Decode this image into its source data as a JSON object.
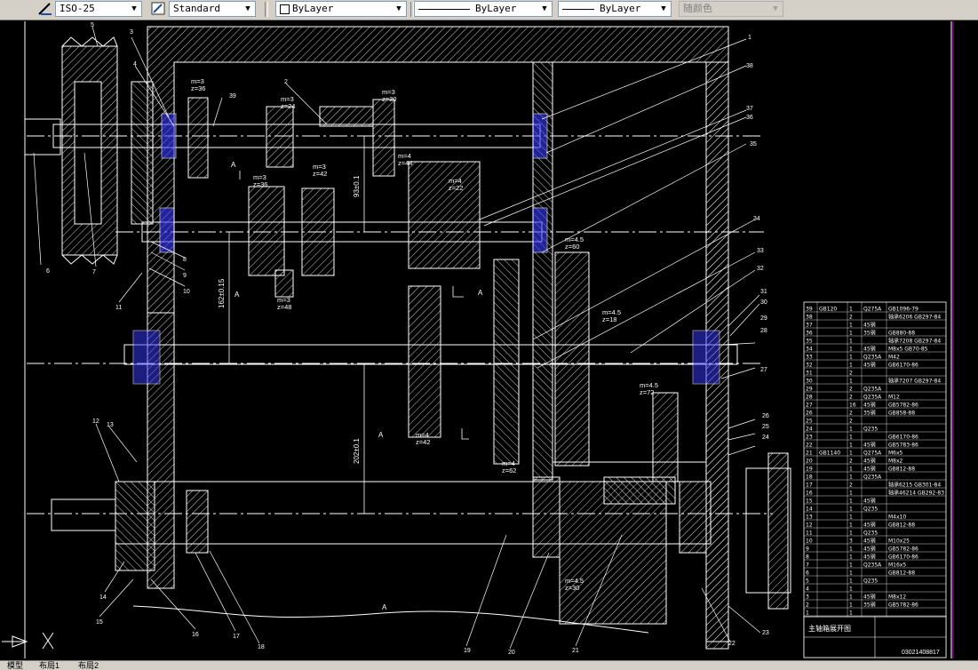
{
  "toolbar": {
    "dimstyle": "ISO-25",
    "textstyle": "Standard",
    "layer": "ByLayer",
    "linetype": "ByLayer",
    "lineweight": "ByLayer",
    "color": "随颜色"
  },
  "layout_tabs": [
    "模型",
    "布局1",
    "布局2"
  ],
  "callouts": [
    "1",
    "2",
    "3",
    "4",
    "5",
    "6",
    "7",
    "8",
    "9",
    "10",
    "11",
    "12",
    "13",
    "14",
    "15",
    "16",
    "17",
    "18",
    "19",
    "20",
    "21",
    "22",
    "23",
    "24",
    "25",
    "26",
    "27",
    "28",
    "29",
    "30",
    "31",
    "32",
    "33",
    "34",
    "35",
    "36",
    "37",
    "38",
    "39"
  ],
  "gear_notes": {
    "g1": [
      "m=3",
      "z=36"
    ],
    "g2": [
      "m=3",
      "z=24"
    ],
    "g3": [
      "m=3",
      "z=30"
    ],
    "g4": [
      "m=4",
      "z=44"
    ],
    "g5": [
      "m=3",
      "z=36"
    ],
    "g6": [
      "m=3",
      "z=42"
    ],
    "g7": [
      "m=4",
      "z=22"
    ],
    "g8": [
      "m=3",
      "z=48"
    ],
    "g9": [
      "m=4.5",
      "z=60"
    ],
    "g10": [
      "m=4.5",
      "z=18"
    ],
    "g11": [
      "m=4.5",
      "z=72"
    ],
    "g12": [
      "m=4",
      "z=42"
    ],
    "g13": [
      "m=4",
      "z=62"
    ],
    "g14": [
      "m=4.5",
      "z=30"
    ]
  },
  "dims": {
    "d1": "93±0.1",
    "d2": "162±0.15",
    "d3": "202±0.1"
  },
  "section_mark": "A",
  "bom_rows": [
    [
      "39",
      "GB120",
      "1",
      "Q275A",
      "GB1096-79"
    ],
    [
      "38",
      "",
      "2",
      "",
      "轴承6206 GB297-84"
    ],
    [
      "37",
      "",
      "1",
      "45钢",
      ""
    ],
    [
      "36",
      "",
      "1",
      "35钢",
      "GB880-88"
    ],
    [
      "35",
      "",
      "1",
      "",
      "轴承7208 GB297-84"
    ],
    [
      "34",
      "",
      "1",
      "45钢",
      "M8x5 GB70-85"
    ],
    [
      "33",
      "",
      "1",
      "Q235A",
      "M42"
    ],
    [
      "32",
      "",
      "1",
      "45钢",
      "GB6170-86"
    ],
    [
      "31",
      "",
      "2",
      "",
      ""
    ],
    [
      "30",
      "",
      "1",
      "",
      "轴承7207 GB297-84"
    ],
    [
      "29",
      "",
      "2",
      "Q235A",
      ""
    ],
    [
      "28",
      "",
      "2",
      "Q235A",
      "M12"
    ],
    [
      "27",
      "",
      "16",
      "45钢",
      "GB5782-86"
    ],
    [
      "26",
      "",
      "2",
      "35钢",
      "GB858-88"
    ],
    [
      "25",
      "",
      "2",
      "",
      ""
    ],
    [
      "24",
      "",
      "1",
      "Q235",
      ""
    ],
    [
      "23",
      "",
      "1",
      "",
      "GB6170-86"
    ],
    [
      "22",
      "",
      "1",
      "45钢",
      "GB5783-86"
    ],
    [
      "21",
      "GB1140",
      "1",
      "Q275A",
      "M6x5"
    ],
    [
      "20",
      "",
      "2",
      "45钢",
      "M8x2"
    ],
    [
      "19",
      "",
      "1",
      "45钢",
      "GB812-88"
    ],
    [
      "18",
      "",
      "1",
      "Q235A",
      ""
    ],
    [
      "17",
      "",
      "2",
      "",
      "轴承6215 GB301-84"
    ],
    [
      "16",
      "",
      "1",
      "",
      "轴承46214 GB292-83"
    ],
    [
      "15",
      "",
      "1",
      "45钢",
      ""
    ],
    [
      "14",
      "",
      "1",
      "Q235",
      ""
    ],
    [
      "13",
      "",
      "1",
      "",
      "M4x10"
    ],
    [
      "12",
      "",
      "1",
      "45钢",
      "GB812-88"
    ],
    [
      "11",
      "",
      "1",
      "Q235",
      ""
    ],
    [
      "10",
      "",
      "3",
      "45钢",
      "M10x25"
    ],
    [
      "9",
      "",
      "1",
      "45钢",
      "GB5782-86"
    ],
    [
      "8",
      "",
      "1",
      "45钢",
      "GB6170-86"
    ],
    [
      "7",
      "",
      "1",
      "Q235A",
      "M16x5"
    ],
    [
      "6",
      "",
      "1",
      "",
      "GB812-88"
    ],
    [
      "5",
      "",
      "1",
      "Q235",
      ""
    ],
    [
      "4",
      "",
      "1",
      "",
      ""
    ],
    [
      "3",
      "",
      "1",
      "45钢",
      "M8x12"
    ],
    [
      "2",
      "",
      "1",
      "35钢",
      "GB5782-86"
    ],
    [
      "1",
      "",
      "1",
      "",
      ""
    ]
  ],
  "title_block": {
    "title": "主轴箱展开图",
    "drawing_no": "03021408817"
  },
  "colors": {
    "line": "#ffffff",
    "hatch": "#ffffff",
    "bearing_seal": "#3a3aff",
    "background": "#000000",
    "ui": "#d4d0c8"
  }
}
